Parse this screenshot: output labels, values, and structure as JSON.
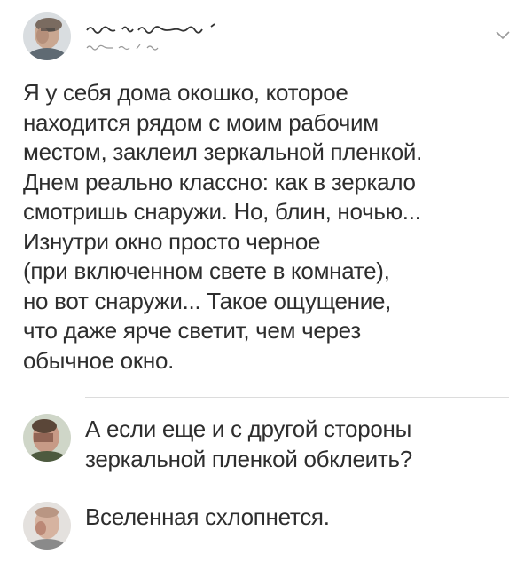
{
  "post": {
    "author_avatar_icon": "user-avatar-blurred",
    "author_name_icon": "obscured-username-scribble",
    "author_handle_icon": "obscured-handle-scribble",
    "menu_icon": "chevron-down-icon",
    "text": "Я у себя дома окошко, которое\nнаходится рядом с моим рабочим\nместом, заклеил зеркальной пленкой.\nДнем реально классно: как в зеркало\nсмотришь снаружи. Но, блин, ночью...\nИзнутри окно просто черное\n(при включенном свете в комнате),\nно вот снаружи... Такое ощущение,\nчто даже ярче светит, чем через\nобычное окно."
  },
  "comments": [
    {
      "avatar_icon": "user-avatar-blurred",
      "text": "А если еще и с другой стороны\nзеркальной пленкой обклеить?"
    },
    {
      "avatar_icon": "user-avatar-blurred",
      "text": "Вселенная схлопнется."
    }
  ],
  "colors": {
    "text": "#2e2e2e",
    "divider": "#dcdcdc",
    "chevron": "#9a9a9a",
    "background": "#ffffff"
  }
}
